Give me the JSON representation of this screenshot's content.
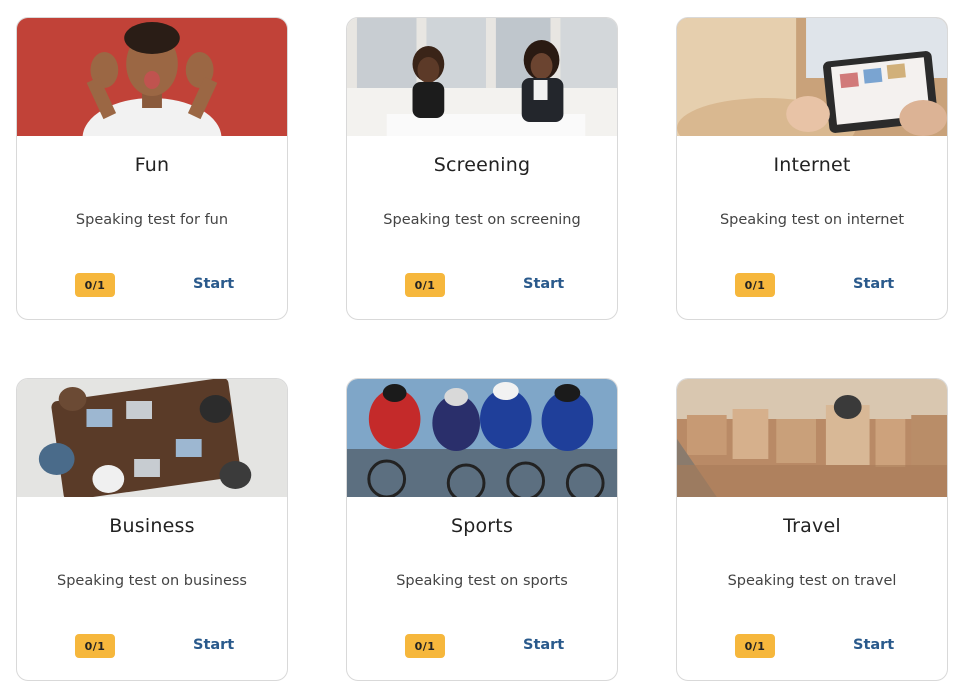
{
  "cards": [
    {
      "title": "Fun",
      "description": "Speaking test for fun",
      "progress": "0/1",
      "action": "Start",
      "image": "person-making-funny-face-photo"
    },
    {
      "title": "Screening",
      "description": "Speaking test on screening",
      "progress": "0/1",
      "action": "Start",
      "image": "two-women-interview-photo"
    },
    {
      "title": "Internet",
      "description": "Speaking test on internet",
      "progress": "0/1",
      "action": "Start",
      "image": "hands-on-tablet-photo"
    },
    {
      "title": "Business",
      "description": "Speaking test on business",
      "progress": "0/1",
      "action": "Start",
      "image": "business-meeting-table-photo"
    },
    {
      "title": "Sports",
      "description": "Speaking test on sports",
      "progress": "0/1",
      "action": "Start",
      "image": "cyclists-racing-photo"
    },
    {
      "title": "Travel",
      "description": "Speaking test on travel",
      "progress": "0/1",
      "action": "Start",
      "image": "city-rooftops-photo"
    }
  ],
  "colors": {
    "badge": "#f6b73c",
    "start_link": "#2a5a8c",
    "border": "#d9d9d9"
  }
}
